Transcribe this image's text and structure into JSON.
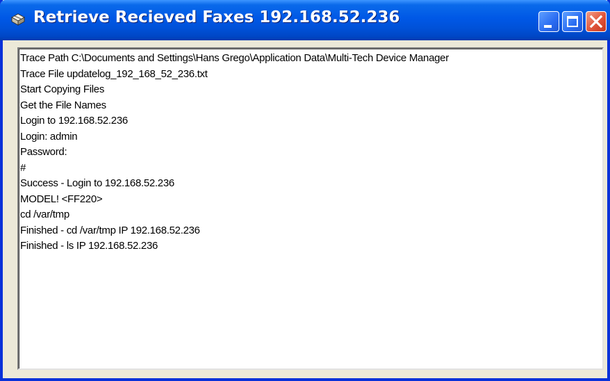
{
  "window": {
    "title": "Retrieve Recieved Faxes 192.168.52.236",
    "icon": "fax-app-icon",
    "controls": [
      "minimize-icon",
      "maximize-icon",
      "close-icon"
    ],
    "accent_color": "#0054e3",
    "close_color": "#e0553a"
  },
  "log": {
    "lines": [
      "Trace Path C:\\Documents and Settings\\Hans Grego\\Application Data\\Multi-Tech Device Manager",
      "Trace File updatelog_192_168_52_236.txt",
      "Start Copying Files",
      "Get the File Names",
      "Login to 192.168.52.236",
      "Login: admin",
      "Password:",
      "#",
      "Success - Login to 192.168.52.236",
      "MODEL! <FF220>",
      "cd /var/tmp",
      "Finished - cd /var/tmp IP 192.168.52.236",
      "Finished - ls IP 192.168.52.236"
    ]
  }
}
